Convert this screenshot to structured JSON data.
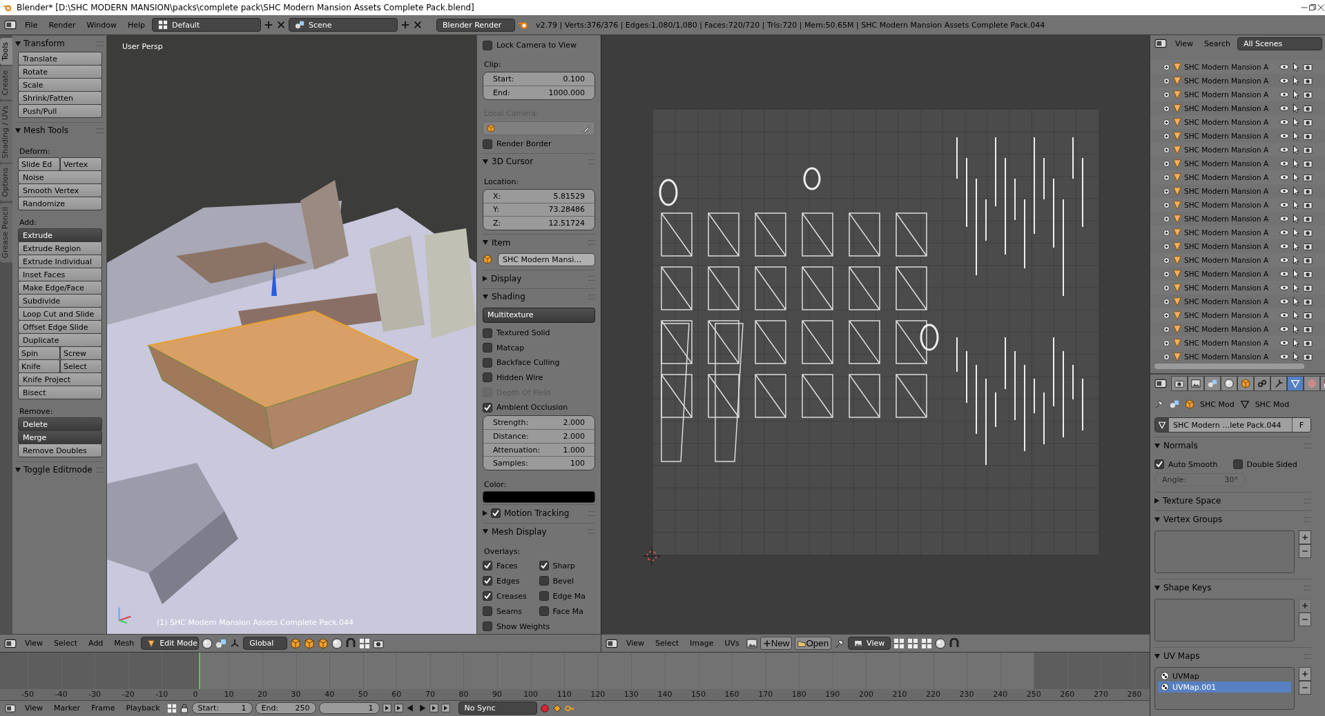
{
  "window": {
    "title": "Blender* [D:\\SHC MODERN MANSION\\packs\\complete pack\\SHC Modern Mansion Assets Complete Pack.blend]"
  },
  "info_header": {
    "menus": [
      "File",
      "Render",
      "Window",
      "Help"
    ],
    "layout": "Default",
    "scene": "Scene",
    "engine": "Blender Render",
    "stats": "v2.79 | Verts:376/376 | Edges:1,080/1,080 | Faces:720/720 | Tris:720 | Mem:50.65M | SHC Modern Mansion Assets Complete Pack.044"
  },
  "tool_shelf": {
    "tabs": [
      {
        "label": "Tools",
        "selected": true
      },
      {
        "label": "Create",
        "selected": false
      },
      {
        "label": "Shading / UVs",
        "selected": false
      },
      {
        "label": "Options",
        "selected": false
      },
      {
        "label": "Grease Pencil",
        "selected": false
      }
    ],
    "panels": [
      {
        "title": "Transform",
        "expanded": true,
        "items": [
          {
            "kind": "button",
            "label": "Translate"
          },
          {
            "kind": "button",
            "label": "Rotate"
          },
          {
            "kind": "button",
            "label": "Scale"
          },
          {
            "kind": "button",
            "label": "Shrink/Fatten"
          },
          {
            "kind": "button",
            "label": "Push/Pull"
          }
        ]
      },
      {
        "title": "Mesh Tools",
        "expanded": true,
        "items": [
          {
            "kind": "label",
            "text": "Deform:"
          },
          {
            "kind": "pair",
            "labels": [
              "Slide Ed",
              "Vertex"
            ]
          },
          {
            "kind": "button",
            "label": "Noise"
          },
          {
            "kind": "button",
            "label": "Smooth Vertex"
          },
          {
            "kind": "button",
            "label": "Randomize"
          },
          {
            "kind": "label",
            "text": "Add:"
          },
          {
            "kind": "dropdown",
            "label": "Extrude"
          },
          {
            "kind": "button",
            "label": "Extrude Region"
          },
          {
            "kind": "button",
            "label": "Extrude Individual"
          },
          {
            "kind": "button",
            "label": "Inset Faces"
          },
          {
            "kind": "button",
            "label": "Make Edge/Face"
          },
          {
            "kind": "button",
            "label": "Subdivide"
          },
          {
            "kind": "button",
            "label": "Loop Cut and Slide"
          },
          {
            "kind": "button",
            "label": "Offset Edge Slide"
          },
          {
            "kind": "button",
            "label": "Duplicate"
          },
          {
            "kind": "pair",
            "labels": [
              "Spin",
              "Screw"
            ]
          },
          {
            "kind": "pair",
            "labels": [
              "Knife",
              "Select"
            ]
          },
          {
            "kind": "button",
            "label": "Knife Project"
          },
          {
            "kind": "button",
            "label": "Bisect"
          },
          {
            "kind": "label",
            "text": "Remove:"
          },
          {
            "kind": "dropdown",
            "label": "Delete"
          },
          {
            "kind": "dropdown",
            "label": "Merge"
          },
          {
            "kind": "button",
            "label": "Remove Doubles"
          }
        ]
      },
      {
        "title": "Toggle Editmode",
        "expanded": true
      }
    ]
  },
  "viewport": {
    "view_name": "User Persp",
    "object_label": "(1) SHC Modern Mansion Assets Complete Pack.044"
  },
  "view_properties": {
    "items": [
      {
        "kind": "check",
        "text": "Lock Camera to View",
        "checked": false,
        "disabled": false
      },
      {
        "kind": "label",
        "text": "Clip:",
        "disabled": false
      },
      {
        "kind": "numgroup",
        "fields": [
          {
            "label": "Start:",
            "value": "0.100"
          },
          {
            "label": "End:",
            "value": "1000.000"
          }
        ]
      },
      {
        "kind": "label",
        "text": "Local Camera:",
        "disabled": true
      },
      {
        "kind": "picker"
      },
      {
        "kind": "check",
        "text": "Render Border",
        "checked": false,
        "disabled": false
      },
      {
        "kind": "section",
        "title": "3D Cursor",
        "expanded": true
      },
      {
        "kind": "label",
        "text": "Location:",
        "disabled": false
      },
      {
        "kind": "numgroup",
        "fields": [
          {
            "label": "X:",
            "value": "5.81529"
          },
          {
            "label": "Y:",
            "value": "73.28486"
          },
          {
            "label": "Z:",
            "value": "12.51724"
          }
        ]
      },
      {
        "kind": "section",
        "title": "Item",
        "expanded": true
      },
      {
        "kind": "datablock",
        "text": "SHC Modern Mansi…"
      },
      {
        "kind": "section",
        "title": "Display",
        "expanded": false
      },
      {
        "kind": "section",
        "title": "Shading",
        "expanded": true
      },
      {
        "kind": "dropdown",
        "text": "Multitexture"
      },
      {
        "kind": "check",
        "text": "Textured Solid",
        "checked": false,
        "disabled": false
      },
      {
        "kind": "check",
        "text": "Matcap",
        "checked": false,
        "disabled": false
      },
      {
        "kind": "check",
        "text": "Backface Culling",
        "checked": false,
        "disabled": false
      },
      {
        "kind": "check",
        "text": "Hidden Wire",
        "checked": false,
        "disabled": false
      },
      {
        "kind": "check",
        "text": "Depth Of Field",
        "checked": false,
        "disabled": true
      },
      {
        "kind": "check",
        "text": "Ambient Occlusion",
        "checked": true,
        "disabled": false
      },
      {
        "kind": "numgroup",
        "fields": [
          {
            "label": "Strength:",
            "value": "2.000"
          },
          {
            "label": "Distance:",
            "value": "2.000"
          },
          {
            "label": "Attenuation:",
            "value": "1.000"
          },
          {
            "label": "Samples:",
            "value": "100"
          }
        ]
      },
      {
        "kind": "label",
        "text": "Color:",
        "disabled": false
      },
      {
        "kind": "swatch",
        "color": "#000000"
      },
      {
        "kind": "checksection",
        "title": "Motion Tracking",
        "expanded": false,
        "checked": true
      },
      {
        "kind": "section",
        "title": "Mesh Display",
        "expanded": true
      },
      {
        "kind": "label",
        "text": "Overlays:",
        "disabled": false
      },
      {
        "kind": "checkrow",
        "checks": [
          {
            "text": "Faces",
            "checked": true
          },
          {
            "text": "Sharp",
            "checked": true
          }
        ]
      },
      {
        "kind": "checkrow",
        "checks": [
          {
            "text": "Edges",
            "checked": true
          },
          {
            "text": "Bevel",
            "checked": false
          }
        ]
      },
      {
        "kind": "checkrow",
        "checks": [
          {
            "text": "Creases",
            "checked": true
          },
          {
            "text": "Edge Ma",
            "checked": false
          }
        ]
      },
      {
        "kind": "checkrow",
        "checks": [
          {
            "text": "Seams",
            "checked": false
          },
          {
            "text": "Face Ma",
            "checked": false
          }
        ]
      },
      {
        "kind": "check",
        "text": "Show Weights",
        "checked": false,
        "disabled": false
      }
    ]
  },
  "view3d_header": {
    "menus": [
      "View",
      "Select",
      "Add",
      "Mesh"
    ],
    "mode": "Edit Mode",
    "orientation": "Global"
  },
  "uv_header": {
    "menus": [
      "View",
      "Select",
      "Image",
      "UVs"
    ],
    "new_label": "New",
    "open_label": "Open",
    "view_label": "View"
  },
  "timeline": {
    "ticks": [
      "-50",
      "-40",
      "-30",
      "-20",
      "-10",
      "0",
      "10",
      "20",
      "30",
      "40",
      "50",
      "60",
      "70",
      "80",
      "90",
      "100",
      "110",
      "120",
      "130",
      "140",
      "150",
      "160",
      "170",
      "180",
      "190",
      "200",
      "210",
      "220",
      "230",
      "240",
      "250",
      "260",
      "270",
      "280"
    ]
  },
  "timeline_header": {
    "menus": [
      "View",
      "Marker",
      "Frame",
      "Playback"
    ],
    "start": {
      "label": "Start:",
      "value": "1"
    },
    "end": {
      "label": "End:",
      "value": "250"
    },
    "current_frame": "1",
    "sync": "No Sync"
  },
  "outliner": {
    "menus": [
      "View",
      "Search"
    ],
    "filter": "All Scenes",
    "rows": [
      {
        "name": "SHC Modern Mansion A"
      },
      {
        "name": "SHC Modern Mansion A"
      },
      {
        "name": "SHC Modern Mansion A"
      },
      {
        "name": "SHC Modern Mansion A"
      },
      {
        "name": "SHC Modern Mansion A"
      },
      {
        "name": "SHC Modern Mansion A"
      },
      {
        "name": "SHC Modern Mansion A"
      },
      {
        "name": "SHC Modern Mansion A"
      },
      {
        "name": "SHC Modern Mansion A"
      },
      {
        "name": "SHC Modern Mansion A"
      },
      {
        "name": "SHC Modern Mansion A"
      },
      {
        "name": "SHC Modern Mansion A"
      },
      {
        "name": "SHC Modern Mansion A"
      },
      {
        "name": "SHC Modern Mansion A"
      },
      {
        "name": "SHC Modern Mansion A"
      },
      {
        "name": "SHC Modern Mansion A"
      },
      {
        "name": "SHC Modern Mansion A"
      },
      {
        "name": "SHC Modern Mansion A"
      },
      {
        "name": "SHC Modern Mansion A"
      },
      {
        "name": "SHC Modern Mansion A"
      },
      {
        "name": "SHC Modern Mansion A"
      },
      {
        "name": "SHC Modern Mansion A"
      }
    ]
  },
  "properties": {
    "context_tabs": [
      {
        "kind": "render",
        "selected": false
      },
      {
        "kind": "layers",
        "selected": false
      },
      {
        "kind": "scene",
        "selected": false
      },
      {
        "kind": "world",
        "selected": false
      },
      {
        "kind": "object",
        "selected": false
      },
      {
        "kind": "constraints",
        "selected": false
      },
      {
        "kind": "modifiers",
        "selected": false
      },
      {
        "kind": "mesh",
        "selected": true
      },
      {
        "kind": "material",
        "selected": false
      },
      {
        "kind": "texture",
        "selected": false
      }
    ],
    "breadcrumb": [
      "SHC Mod",
      "SHC Mod"
    ],
    "mesh_name": "SHC Modern …lete Pack.044",
    "fake_user": "F",
    "sections": [
      {
        "title": "Normals",
        "expanded": true,
        "items": [
          {
            "kind": "checkrow",
            "checks": [
              {
                "text": "Auto Smooth",
                "checked": true
              },
              {
                "text": "Double Sided",
                "checked": false
              }
            ]
          },
          {
            "kind": "angle",
            "label": "Angle:",
            "value": "30°",
            "disabled": true
          }
        ]
      },
      {
        "title": "Texture Space",
        "expanded": false
      },
      {
        "title": "Vertex Groups",
        "expanded": true,
        "items": [
          {
            "kind": "list",
            "add_disabled": false
          }
        ]
      },
      {
        "title": "Shape Keys",
        "expanded": true,
        "items": [
          {
            "kind": "list",
            "add_disabled": true
          }
        ]
      },
      {
        "title": "UV Maps",
        "expanded": true,
        "items": [
          {
            "kind": "list",
            "add_disabled": false,
            "entries": [
              {
                "name": "UVMap",
                "selected": false
              },
              {
                "name": "UVMap.001",
                "selected": true
              }
            ]
          }
        ]
      }
    ]
  }
}
